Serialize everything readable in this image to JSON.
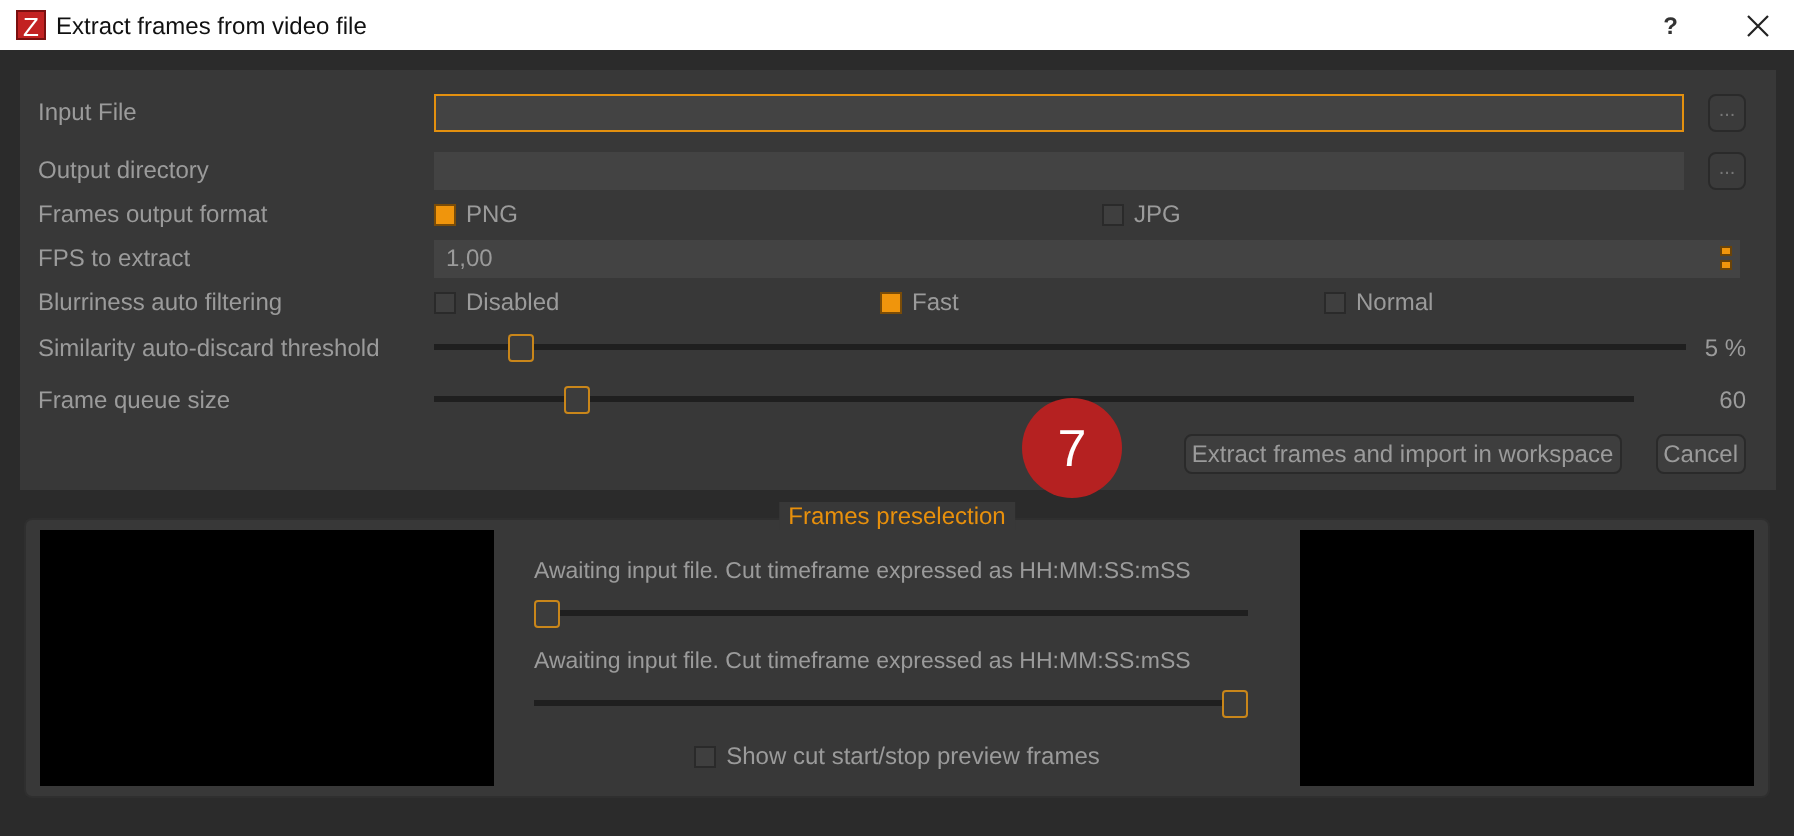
{
  "window": {
    "icon_letter": "Z",
    "title": "Extract frames from video file",
    "help": "?"
  },
  "form": [
    {
      "kind": "file",
      "label": "Input File",
      "focused": true,
      "browse": "..."
    },
    {
      "kind": "file",
      "label": "Output directory",
      "focused": false,
      "browse": "..."
    },
    {
      "kind": "choice",
      "label": "Frames output format",
      "options": [
        {
          "label": "PNG",
          "selected": true
        },
        {
          "label": "JPG",
          "selected": false
        }
      ]
    },
    {
      "kind": "spin",
      "label": "FPS to extract",
      "value": "1,00"
    },
    {
      "kind": "choice",
      "label": "Blurriness auto filtering",
      "options": [
        {
          "label": "Disabled",
          "selected": false
        },
        {
          "label": "Fast",
          "selected": true
        },
        {
          "label": "Normal",
          "selected": false
        }
      ]
    },
    {
      "kind": "slider",
      "label": "Similarity auto-discard threshold",
      "level": 0.06,
      "reading": "5 %"
    },
    {
      "kind": "slider",
      "label": "Frame queue size",
      "level": 0.11,
      "reading": "60"
    }
  ],
  "step_badge": "7",
  "buttons": [
    {
      "label": "Extract frames and import in workspace"
    },
    {
      "label": "Cancel"
    }
  ],
  "preselection": {
    "title": "Frames preselection",
    "cuts": [
      {
        "text": "Awaiting input file. Cut timeframe expressed as HH:MM:SS:mSS",
        "level": 0
      },
      {
        "text": "Awaiting input file. Cut timeframe expressed as HH:MM:SS:mSS",
        "level": 1
      }
    ],
    "show_preview": {
      "label": "Show cut start/stop preview frames",
      "checked": false
    }
  }
}
